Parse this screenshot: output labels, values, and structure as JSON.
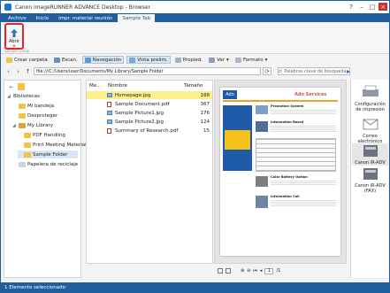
{
  "window": {
    "title": "Canon imageRUNNER ADVANCE Desktop - Browser"
  },
  "ribbon": {
    "tabs": [
      "Archivo",
      "Inicio",
      "Impr. material reunión",
      "Sample Tab"
    ],
    "open_label": "Abrir",
    "group_label": "Sample Group"
  },
  "toolbar": {
    "create_folder": "Crear carpeta",
    "scan": "Escan.",
    "navigation": "Navegación",
    "view_preview": "Vista prelim.",
    "properties": "Propied.",
    "view": "Ver",
    "format": "Formato"
  },
  "address": {
    "path": "file:///C:/Users/user/Documents/My Library/Sample Folder",
    "search_placeholder": "Palabras clave de búsqueda"
  },
  "tree": {
    "root": "Bibliotecas",
    "items": [
      "Mi bandeja",
      "Desproteger",
      "My Library",
      "PDF Handling",
      "Print Meeting Materials",
      "Sample Folder",
      "Papelera de reciclaje"
    ]
  },
  "files": {
    "columns": {
      "mark": "Me...",
      "name": "Nombre",
      "size": "Tamaño"
    },
    "rows": [
      {
        "name": "Homepage.jpg",
        "size": "188",
        "type": "img"
      },
      {
        "name": "Sample Document.pdf",
        "size": "367",
        "type": "pdf"
      },
      {
        "name": "Sample Picture1.jpg",
        "size": "176",
        "type": "img"
      },
      {
        "name": "Sample Picture2.jpg",
        "size": "124",
        "type": "img"
      },
      {
        "name": "Summary of Research.pdf",
        "size": "15",
        "type": "pdf"
      }
    ]
  },
  "preview": {
    "doc_heading": "Ado Services",
    "sections": [
      "Promotion System",
      "Information Board",
      "Color Battery Option",
      "Information Call"
    ],
    "page_number": "1",
    "page_total": "/1"
  },
  "right_panel": {
    "items": [
      "Configuración de impresión",
      "Correo electrónico",
      "Canon iR-ADV",
      "Canon iR-ADV (FAX)"
    ]
  },
  "status": {
    "text": "1 Elemento seleccionado"
  },
  "colors": {
    "accent": "#1f5f9d",
    "highlight": "#e0252b",
    "selected_row": "#fbf08a"
  }
}
